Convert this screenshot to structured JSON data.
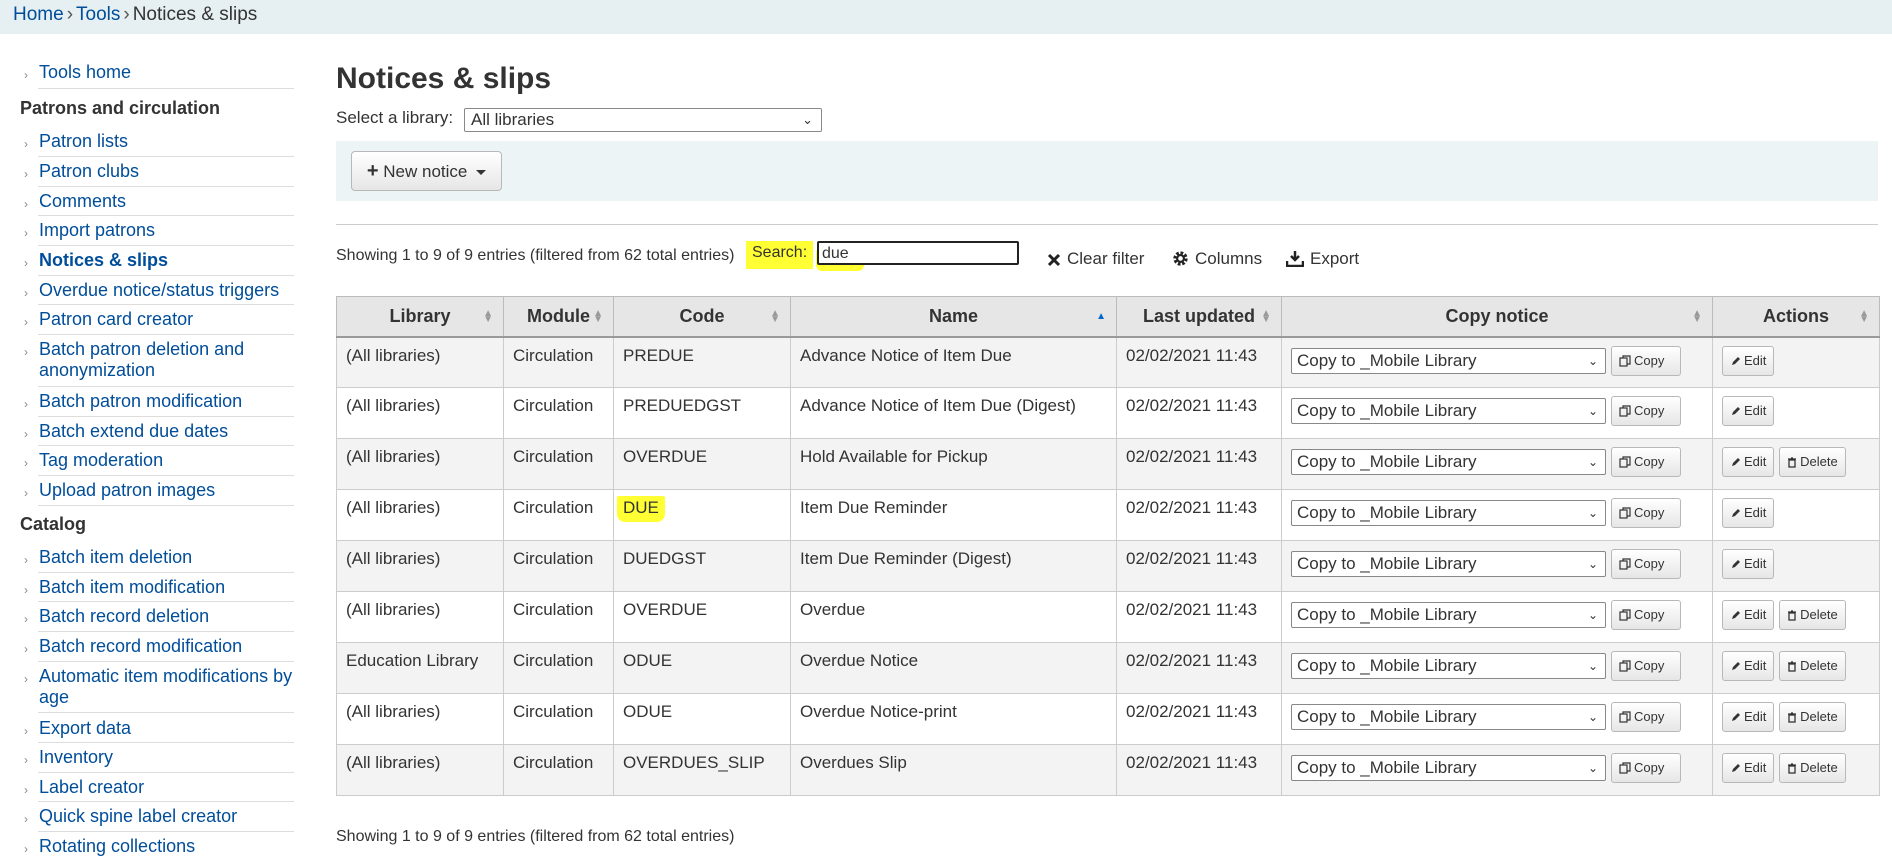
{
  "breadcrumb": {
    "home": "Home",
    "tools": "Tools",
    "current": "Notices & slips",
    "sep": "›"
  },
  "sidebar": {
    "tools_home": "Tools home",
    "section1": "Patrons and circulation",
    "patron_items": [
      "Patron lists",
      "Patron clubs",
      "Comments",
      "Import patrons",
      "Notices & slips",
      "Overdue notice/status triggers",
      "Patron card creator",
      "Batch patron deletion and anonymization",
      "Batch patron modification",
      "Batch extend due dates",
      "Tag moderation",
      "Upload patron images"
    ],
    "section2": "Catalog",
    "catalog_items": [
      "Batch item deletion",
      "Batch item modification",
      "Batch record deletion",
      "Batch record modification",
      "Automatic item modifications by age",
      "Export data",
      "Inventory",
      "Label creator",
      "Quick spine label creator",
      "Rotating collections"
    ]
  },
  "page": {
    "title": "Notices & slips",
    "library_label": "Select a library:",
    "library_value": "All libraries",
    "new_notice": "New notice"
  },
  "filter": {
    "info": "Showing 1 to 9 of 9 entries (filtered from 62 total entries)",
    "search_label": "Search:",
    "search_value": "due",
    "clear_filter": "Clear filter",
    "columns": "Columns",
    "export": "Export"
  },
  "table": {
    "headers": [
      "Library",
      "Module",
      "Code",
      "Name",
      "Last updated",
      "Copy notice",
      "Actions"
    ],
    "copy_value": "Copy to _Mobile Library",
    "copy_btn": "Copy",
    "edit_btn": "Edit",
    "delete_btn": "Delete",
    "rows": [
      {
        "library": "(All libraries)",
        "module": "Circulation",
        "code": "PREDUE",
        "name": "Advance Notice of Item Due",
        "updated": "02/02/2021 11:43"
      },
      {
        "library": "(All libraries)",
        "module": "Circulation",
        "code": "PREDUEDGST",
        "name": "Advance Notice of Item Due (Digest)",
        "updated": "02/02/2021 11:43"
      },
      {
        "library": "(All libraries)",
        "module": "Circulation",
        "code": "OVERDUE",
        "name": "Hold Available for Pickup",
        "updated": "02/02/2021 11:43"
      },
      {
        "library": "(All libraries)",
        "module": "Circulation",
        "code": "DUE",
        "name": "Item Due Reminder",
        "updated": "02/02/2021 11:43"
      },
      {
        "library": "(All libraries)",
        "module": "Circulation",
        "code": "DUEDGST",
        "name": "Item Due Reminder (Digest)",
        "updated": "02/02/2021 11:43"
      },
      {
        "library": "(All libraries)",
        "module": "Circulation",
        "code": "OVERDUE",
        "name": "Overdue",
        "updated": "02/02/2021 11:43"
      },
      {
        "library": "Education Library",
        "module": "Circulation",
        "code": "ODUE",
        "name": "Overdue Notice",
        "updated": "02/02/2021 11:43"
      },
      {
        "library": "(All libraries)",
        "module": "Circulation",
        "code": "ODUE",
        "name": "Overdue Notice-print",
        "updated": "02/02/2021 11:43"
      },
      {
        "library": "(All libraries)",
        "module": "Circulation",
        "code": "OVERDUES_SLIP",
        "name": "Overdues Slip",
        "updated": "02/02/2021 11:43"
      }
    ]
  },
  "highlight_color": "#ffff33",
  "link_color": "#004d99"
}
